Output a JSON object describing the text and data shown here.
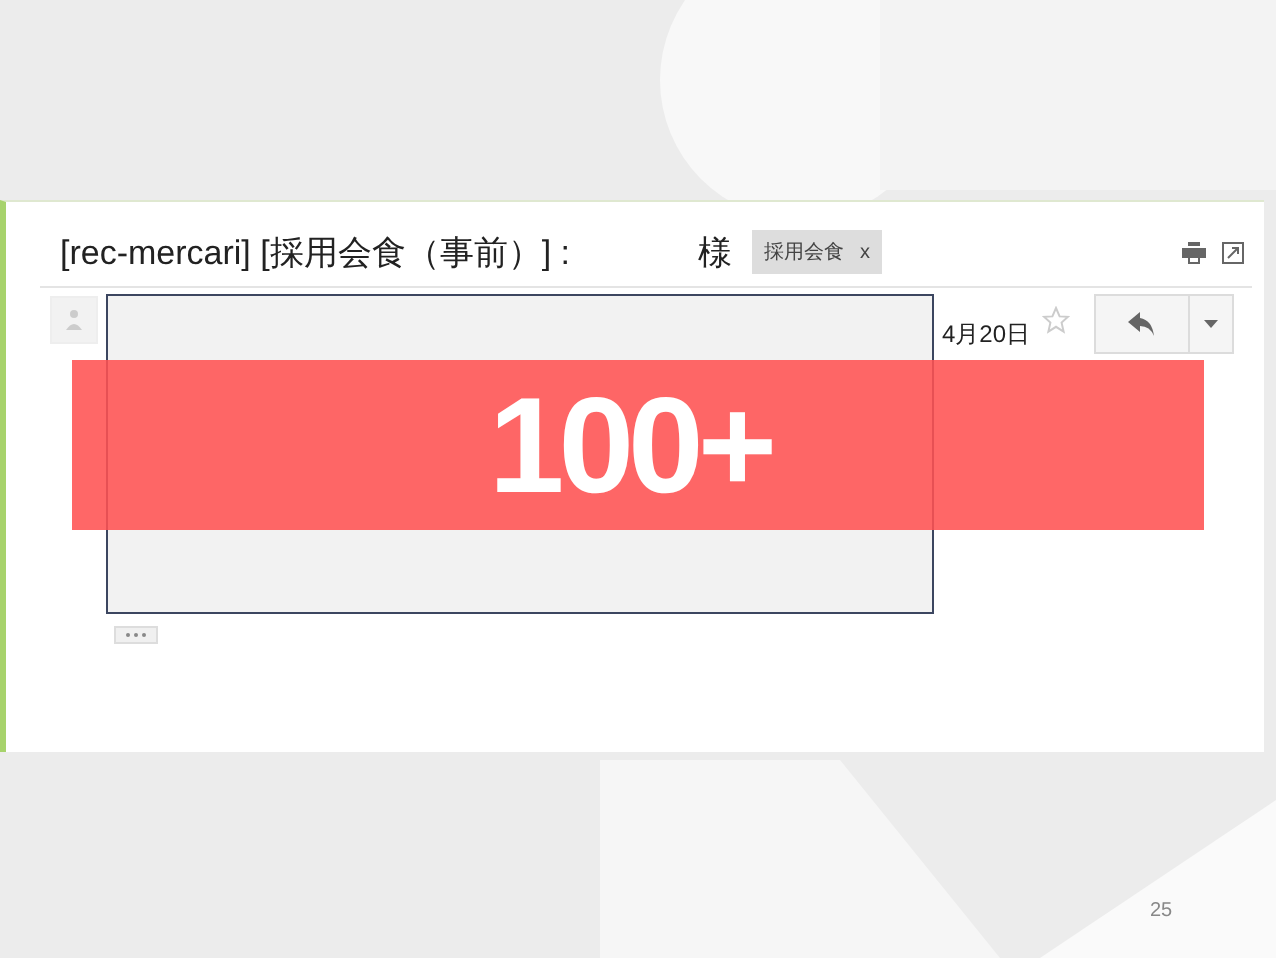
{
  "email": {
    "subject": "[rec-mercari] [採用会食（事前）] :",
    "subject_suffix": "様",
    "labels": [
      {
        "text": "採用会食",
        "remove": "x"
      }
    ],
    "date": "4月20日",
    "starred": false
  },
  "overlay_badge": "100+",
  "slide_number": "25"
}
